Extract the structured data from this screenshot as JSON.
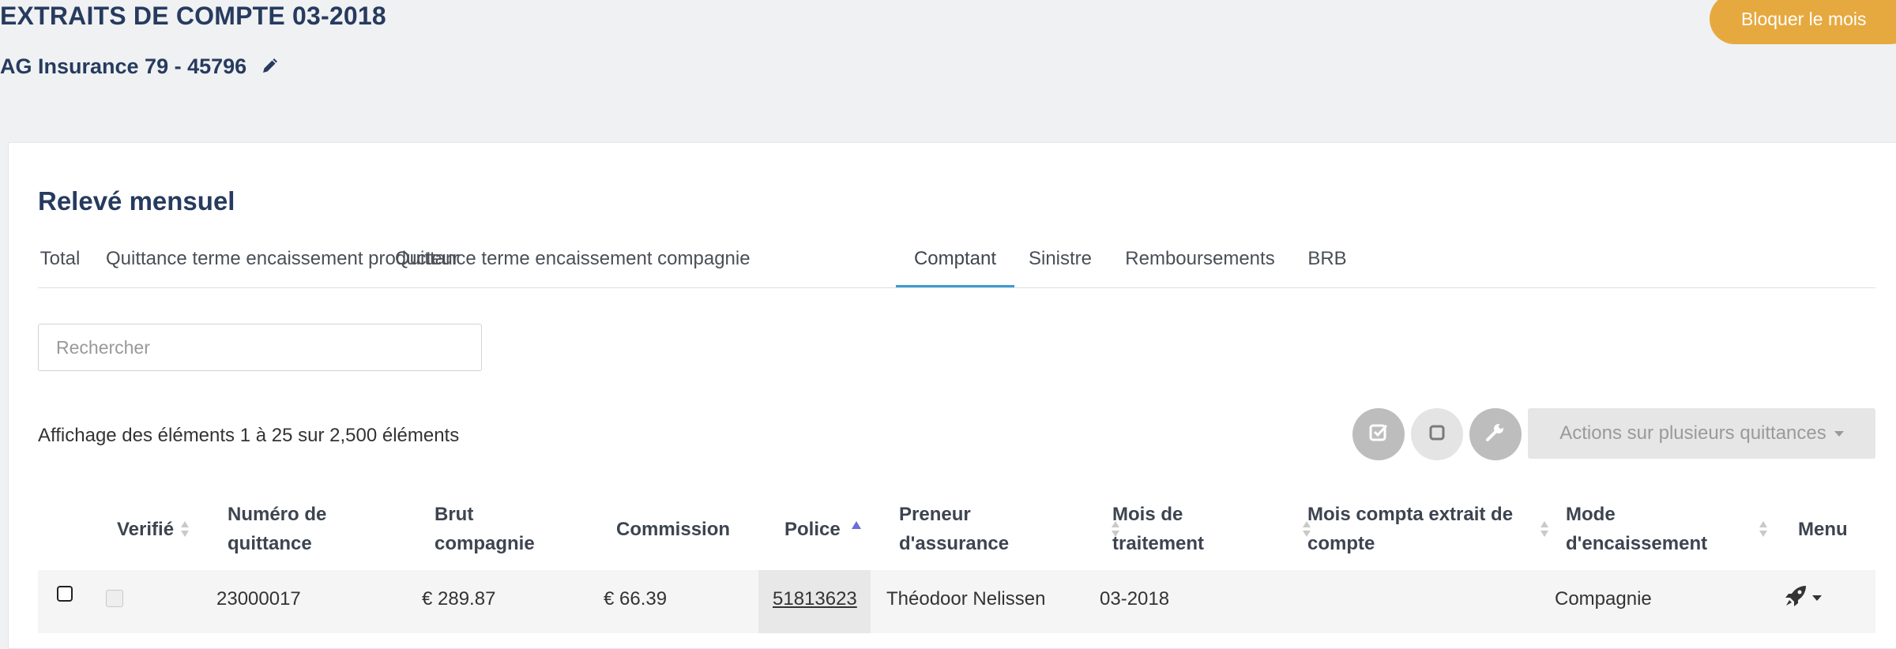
{
  "header": {
    "title": "EXTRAITS DE COMPTE 03-2018",
    "subtitle": "AG Insurance 79 - 45796",
    "block_button": "Bloquer le mois"
  },
  "card": {
    "title": "Relevé mensuel",
    "tabs": [
      {
        "label": "Total"
      },
      {
        "label": "Quittance terme encaissement producteur"
      },
      {
        "label": "Quittance terme encaissement compagnie"
      },
      {
        "label": "Comptant"
      },
      {
        "label": "Sinistre"
      },
      {
        "label": "Remboursements"
      },
      {
        "label": "BRB"
      }
    ],
    "active_tab": "Comptant",
    "search_placeholder": "Rechercher",
    "info": "Affichage des éléments 1 à 25 sur 2,500 éléments",
    "actions_button": "Actions sur plusieurs quittances"
  },
  "table": {
    "columns": [
      {
        "label": "Verifié"
      },
      {
        "label": "Numéro de\nquittance"
      },
      {
        "label": "Brut\ncompagnie"
      },
      {
        "label": "Commission"
      },
      {
        "label": "Police"
      },
      {
        "label": "Preneur\nd'assurance"
      },
      {
        "label": "Mois de\ntraitement"
      },
      {
        "label": "Mois compta extrait de\ncompte"
      },
      {
        "label": "Mode\nd'encaissement"
      },
      {
        "label": "Menu"
      }
    ],
    "rows": [
      {
        "numero": "23000017",
        "brut": "€ 289.87",
        "commission": "€ 66.39",
        "police": "51813623",
        "preneur": "Théodoor Nelissen",
        "mois_traitement": "03-2018",
        "mois_compta": "",
        "mode": "Compagnie"
      }
    ]
  },
  "colors": {
    "accent_orange": "#e6a93f",
    "tab_active": "#3d9bd1",
    "title_navy": "#263b5e",
    "sort_active": "#6b6fd6"
  },
  "icons": [
    "pencil-icon",
    "check-square-icon",
    "square-icon",
    "wrench-icon",
    "rocket-icon",
    "sort-icon",
    "sort-up-icon",
    "caret-down-icon"
  ]
}
